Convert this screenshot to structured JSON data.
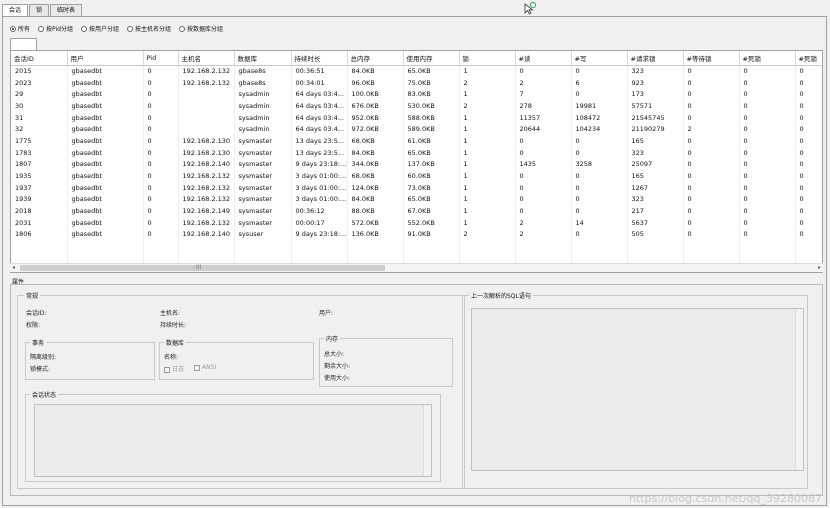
{
  "tabs": [
    "会话",
    "锁",
    "临时表"
  ],
  "filters": {
    "options": [
      "所有",
      "按Pid分组",
      "按用户分组",
      "按主机名分组",
      "按数据库分组"
    ],
    "selected": 0
  },
  "grid": {
    "columns": [
      "会话ID",
      "用户",
      "Pid",
      "主机名",
      "数据库",
      "持续时长",
      "总内存",
      "使用内存",
      "锁",
      "#读",
      "#写",
      "#请求锁",
      "#等待锁",
      "#死锁",
      "#死锁"
    ],
    "rows": [
      [
        "2015",
        "gbasedbt",
        "0",
        "192.168.2.132",
        "gbase8s",
        "00:36:51",
        "84.0KB",
        "65.0KB",
        "1",
        "0",
        "0",
        "323",
        "0",
        "0",
        "0"
      ],
      [
        "2023",
        "gbasedbt",
        "0",
        "192.168.2.132",
        "gbase8s",
        "00:34:01",
        "96.0KB",
        "75.0KB",
        "2",
        "2",
        "6",
        "923",
        "0",
        "0",
        "0"
      ],
      [
        "29",
        "gbasedbt",
        "0",
        "",
        "sysadmin",
        "64 days 03:4...",
        "100.0KB",
        "83.0KB",
        "1",
        "7",
        "0",
        "173",
        "0",
        "0",
        "0"
      ],
      [
        "30",
        "gbasedbt",
        "0",
        "",
        "sysadmin",
        "64 days 03:4...",
        "676.0KB",
        "530.0KB",
        "2",
        "278",
        "19981",
        "57571",
        "0",
        "0",
        "0"
      ],
      [
        "31",
        "gbasedbt",
        "0",
        "",
        "sysadmin",
        "64 days 03:4...",
        "952.0KB",
        "588.0KB",
        "1",
        "11357",
        "108472",
        "21545745",
        "0",
        "0",
        "0"
      ],
      [
        "32",
        "gbasedbt",
        "0",
        "",
        "sysadmin",
        "64 days 03:4...",
        "972.0KB",
        "589.0KB",
        "1",
        "20644",
        "104234",
        "21190279",
        "2",
        "0",
        "0"
      ],
      [
        "1775",
        "gbasedbt",
        "0",
        "192.168.2.130",
        "sysmaster",
        "13 days 23:5...",
        "68.0KB",
        "61.0KB",
        "1",
        "0",
        "0",
        "165",
        "0",
        "0",
        "0"
      ],
      [
        "1783",
        "gbasedbt",
        "0",
        "192.168.2.130",
        "sysmaster",
        "13 days 23:5...",
        "84.0KB",
        "65.0KB",
        "1",
        "0",
        "0",
        "323",
        "0",
        "0",
        "0"
      ],
      [
        "1807",
        "gbasedbt",
        "0",
        "192.168.2.140",
        "sysmaster",
        "9 days 23:18:...",
        "344.0KB",
        "137.0KB",
        "1",
        "1435",
        "3258",
        "25097",
        "0",
        "0",
        "0"
      ],
      [
        "1935",
        "gbasedbt",
        "0",
        "192.168.2.132",
        "sysmaster",
        "3 days 01:00:...",
        "68.0KB",
        "60.0KB",
        "1",
        "0",
        "0",
        "165",
        "0",
        "0",
        "0"
      ],
      [
        "1937",
        "gbasedbt",
        "0",
        "192.168.2.132",
        "sysmaster",
        "3 days 01:00:...",
        "124.0KB",
        "73.0KB",
        "1",
        "0",
        "0",
        "1267",
        "0",
        "0",
        "0"
      ],
      [
        "1939",
        "gbasedbt",
        "0",
        "192.168.2.132",
        "sysmaster",
        "3 days 01:00:...",
        "84.0KB",
        "65.0KB",
        "1",
        "0",
        "0",
        "323",
        "0",
        "0",
        "0"
      ],
      [
        "2018",
        "gbasedbt",
        "0",
        "192.168.2.149",
        "sysmaster",
        "00:36:12",
        "88.0KB",
        "67.0KB",
        "1",
        "0",
        "0",
        "217",
        "0",
        "0",
        "0"
      ],
      [
        "2031",
        "gbasedbt",
        "0",
        "192.168.2.132",
        "sysmaster",
        "00:00:17",
        "572.0KB",
        "552.0KB",
        "1",
        "2",
        "14",
        "5637",
        "0",
        "0",
        "0"
      ],
      [
        "1806",
        "gbasedbt",
        "0",
        "192.168.2.140",
        "sysuser",
        "9 days 23:18:...",
        "136.0KB",
        "91.0KB",
        "2",
        "2",
        "0",
        "505",
        "0",
        "0",
        "0"
      ]
    ],
    "scroll_indicator": "III"
  },
  "properties": {
    "title": "属性",
    "general": {
      "title": "常规",
      "session_id": "会话ID:",
      "privilege": "权限:",
      "hostname": "主机名:",
      "duration": "持续时长:",
      "user": "用户:"
    },
    "transaction": {
      "title": "事务",
      "isolation": "隔离级别:",
      "lock_mode": "锁模式:"
    },
    "database": {
      "title": "数据库",
      "name": "名称:",
      "log": "日志",
      "ansi": "ANSI"
    },
    "memory": {
      "title": "内存",
      "total": "总大小:",
      "remaining": "剩余大小:",
      "used": "使用大小:"
    },
    "session_state": {
      "title": "会话状态"
    },
    "sql": {
      "title": "上一次解析的SQL语句"
    }
  },
  "watermark": "https://blog.csdn.net/qq_39280087"
}
